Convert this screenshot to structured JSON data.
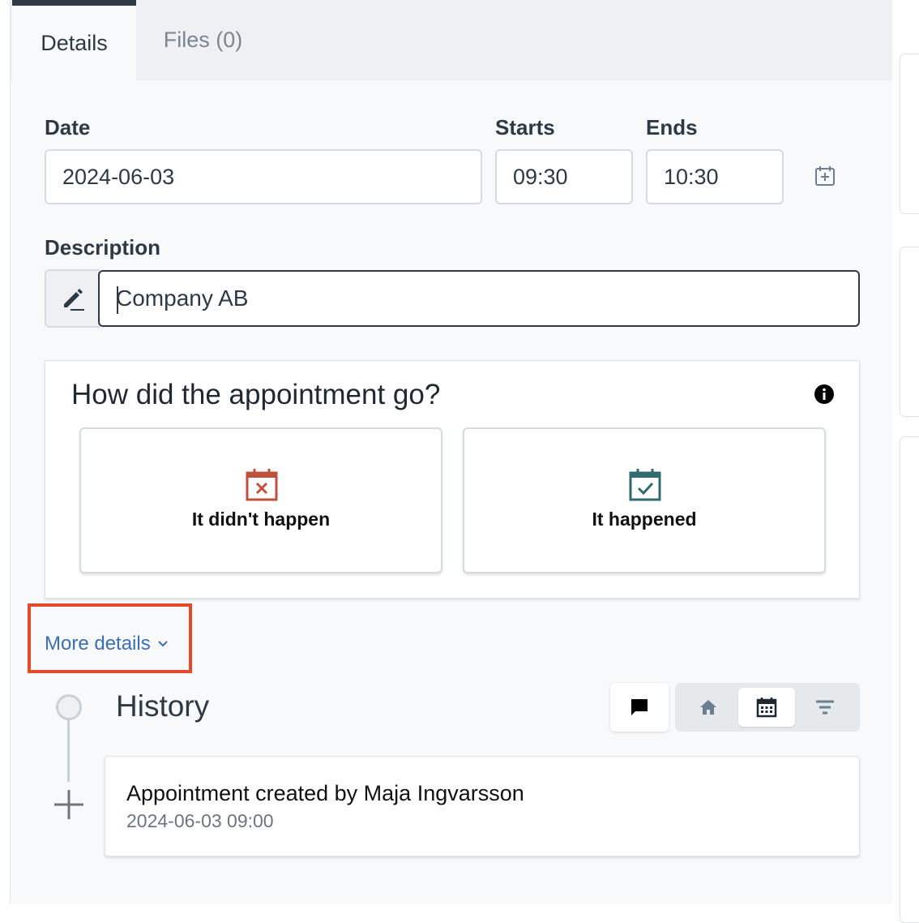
{
  "tabs": [
    {
      "label": "Details"
    },
    {
      "label": "Files (0)"
    }
  ],
  "form": {
    "date_label": "Date",
    "date_value": "2024-06-03",
    "starts_label": "Starts",
    "starts_value": "09:30",
    "ends_label": "Ends",
    "ends_value": "10:30",
    "description_label": "Description",
    "description_value": "Company AB"
  },
  "outcome": {
    "question": "How did the appointment go?",
    "options": [
      {
        "label": "It didn't happen",
        "icon": "calendar-x-icon",
        "color": "#c0503e"
      },
      {
        "label": "It happened",
        "icon": "calendar-check-icon",
        "color": "#2f6b6f"
      }
    ]
  },
  "more_details": {
    "label": "More details"
  },
  "history": {
    "title": "History",
    "filters": [
      "comment-icon",
      "home-icon",
      "calendar-icon",
      "filter-icon"
    ],
    "selected_filter": "calendar-icon",
    "entries": [
      {
        "title": "Appointment created by Maja Ingvarsson",
        "timestamp": "2024-06-03 09:00"
      }
    ]
  },
  "colors": {
    "accent_link": "#3a6fb4",
    "highlight": "#e24a2e",
    "text": "#2d3a45"
  }
}
